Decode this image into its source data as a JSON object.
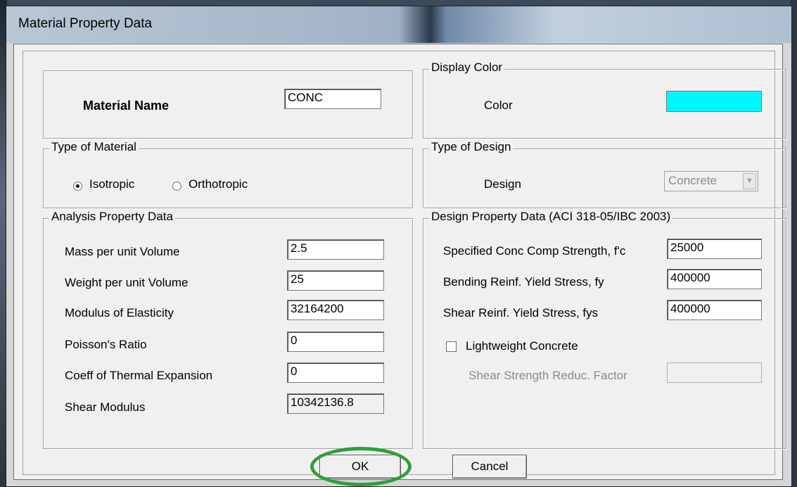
{
  "window": {
    "title": "Material Property Data"
  },
  "material_name": {
    "label": "Material Name",
    "value": "CONC"
  },
  "display_color": {
    "legend": "Display Color",
    "label": "Color",
    "swatch_color": "#00f7ff"
  },
  "type_of_material": {
    "legend": "Type of Material",
    "options": [
      {
        "label": "Isotropic",
        "selected": true
      },
      {
        "label": "Orthotropic",
        "selected": false
      }
    ]
  },
  "type_of_design": {
    "legend": "Type of Design",
    "label": "Design",
    "value": "Concrete"
  },
  "analysis": {
    "legend": "Analysis Property Data",
    "rows": [
      {
        "label": "Mass per unit Volume",
        "value": "2.5"
      },
      {
        "label": "Weight per unit Volume",
        "value": "25"
      },
      {
        "label": "Modulus of Elasticity",
        "value": "32164200"
      },
      {
        "label": "Poisson's Ratio",
        "value": "0"
      },
      {
        "label": "Coeff of Thermal Expansion",
        "value": "0"
      },
      {
        "label": "Shear Modulus",
        "value": "10342136.8"
      }
    ]
  },
  "design": {
    "legend": "Design Property Data (ACI 318-05/IBC 2003)",
    "rows": [
      {
        "label": "Specified Conc Comp Strength, f'c",
        "value": "25000"
      },
      {
        "label": "Bending Reinf. Yield Stress, fy",
        "value": "400000"
      },
      {
        "label": "Shear Reinf. Yield Stress, fys",
        "value": "400000"
      }
    ],
    "lightweight_label": "Lightweight Concrete",
    "lightweight_checked": false,
    "shear_factor_label": "Shear Strength Reduc. Factor",
    "shear_factor_value": ""
  },
  "buttons": {
    "ok": "OK",
    "cancel": "Cancel"
  },
  "highlight_color": "#2ea03a"
}
